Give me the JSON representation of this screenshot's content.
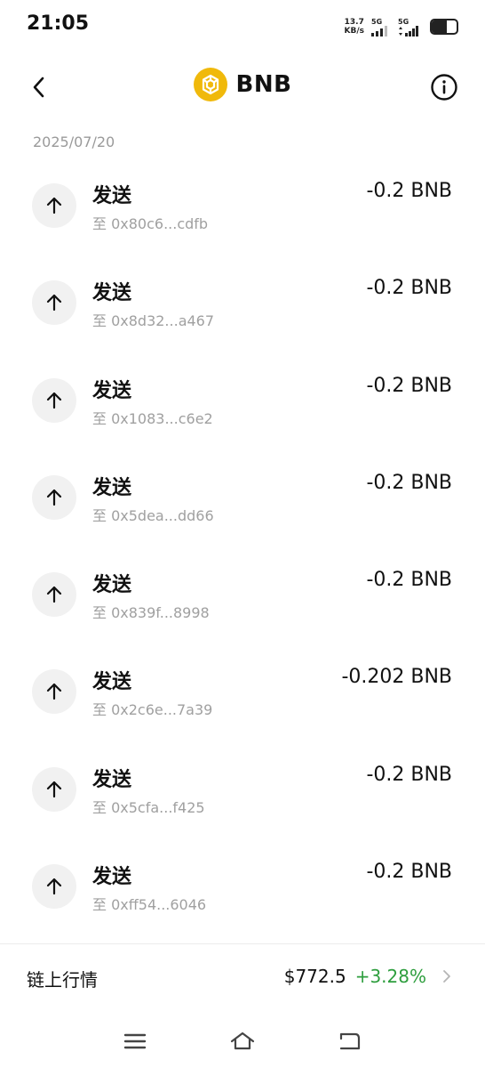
{
  "status_bar": {
    "time": "21:05",
    "net_speed_value": "13.7",
    "net_speed_unit": "KB/s",
    "sim1_label": "5G",
    "sim2_label": "5G",
    "battery_level": 0.6
  },
  "header": {
    "title": "BNB",
    "coin_icon": "bnb-logo",
    "back_icon": "chevron-left-icon",
    "info_icon": "info-circle-icon"
  },
  "date_group": "2025/07/20",
  "transactions": [
    {
      "type": "发送",
      "address": "至 0x80c6...cdfb",
      "amount": "-0.2 BNB"
    },
    {
      "type": "发送",
      "address": "至 0x8d32...a467",
      "amount": "-0.2 BNB"
    },
    {
      "type": "发送",
      "address": "至 0x1083...c6e2",
      "amount": "-0.2 BNB"
    },
    {
      "type": "发送",
      "address": "至 0x5dea...dd66",
      "amount": "-0.2 BNB"
    },
    {
      "type": "发送",
      "address": "至 0x839f...8998",
      "amount": "-0.2 BNB"
    },
    {
      "type": "发送",
      "address": "至 0x2c6e...7a39",
      "amount": "-0.202 BNB"
    },
    {
      "type": "发送",
      "address": "至 0x5cfa...f425",
      "amount": "-0.2 BNB"
    },
    {
      "type": "发送",
      "address": "至 0xff54...6046",
      "amount": "-0.2 BNB"
    }
  ],
  "market": {
    "label": "链上行情",
    "price": "$772.5",
    "change": "+3.28%",
    "change_color": "#2e9e3e"
  },
  "colors": {
    "bnb_yellow": "#F0B90B",
    "text_primary": "#111111",
    "text_secondary": "#a0a0a0"
  }
}
